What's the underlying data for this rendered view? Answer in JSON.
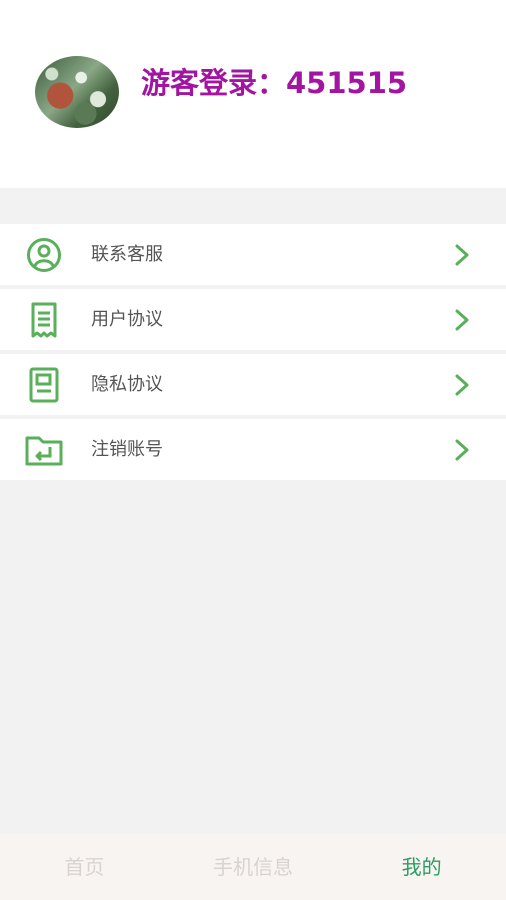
{
  "profile": {
    "username": "游客登录：451515",
    "avatar": "avatar-photo"
  },
  "menu": {
    "items": [
      {
        "label": "联系客服",
        "icon": "user-circle-icon"
      },
      {
        "label": "用户协议",
        "icon": "receipt-icon"
      },
      {
        "label": "隐私协议",
        "icon": "document-icon"
      },
      {
        "label": "注销账号",
        "icon": "folder-return-icon"
      }
    ],
    "chevron_icon": "chevron-right-icon"
  },
  "tabbar": {
    "tabs": [
      {
        "label": "首页",
        "active": false
      },
      {
        "label": "手机信息",
        "active": false
      },
      {
        "label": "我的",
        "active": true
      }
    ]
  },
  "colors": {
    "accent_green": "#5aaf5a",
    "username_purple": "#a214a2",
    "active_tab": "#2e9c63",
    "inactive_tab": "#d9d3d0",
    "background": "#f2f2f2"
  }
}
